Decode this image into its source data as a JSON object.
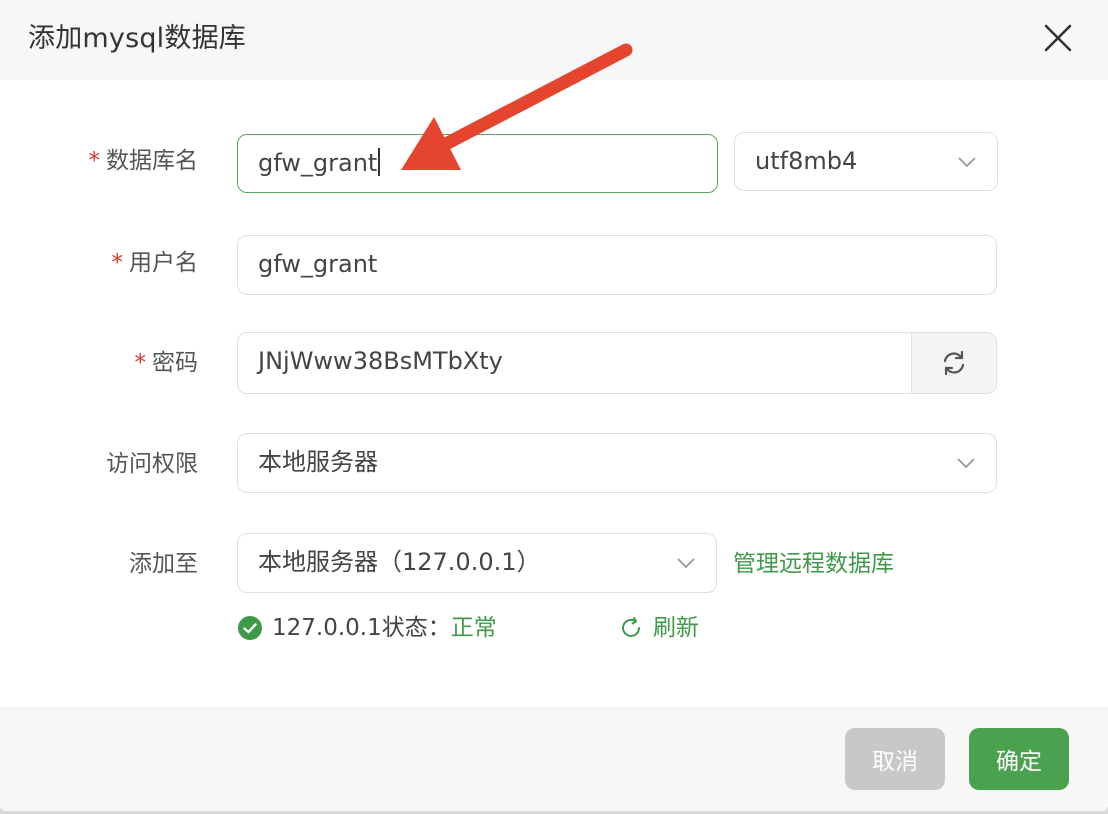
{
  "dialog": {
    "title": "添加mysql数据库"
  },
  "form": {
    "db_name": {
      "required_mark": "*",
      "label": "数据库名",
      "value": "gfw_grant"
    },
    "charset": {
      "value": "utf8mb4"
    },
    "username": {
      "required_mark": "*",
      "label": "用户名",
      "value": "gfw_grant"
    },
    "password": {
      "required_mark": "*",
      "label": "密码",
      "value": "JNjWww38BsMTbXty"
    },
    "access": {
      "label": "访问权限",
      "value": "本地服务器"
    },
    "add_to": {
      "label": "添加至",
      "value": "本地服务器（127.0.0.1）",
      "manage_link": "管理远程数据库"
    },
    "status": {
      "prefix": "127.0.0.1状态：",
      "value": "正常",
      "refresh": "刷新"
    }
  },
  "footer": {
    "cancel_label": "取消",
    "confirm_label": "确定"
  },
  "colors": {
    "accent_green": "#3e9a47",
    "required_red": "#d9352b",
    "annotation_arrow": "#e5452f"
  }
}
